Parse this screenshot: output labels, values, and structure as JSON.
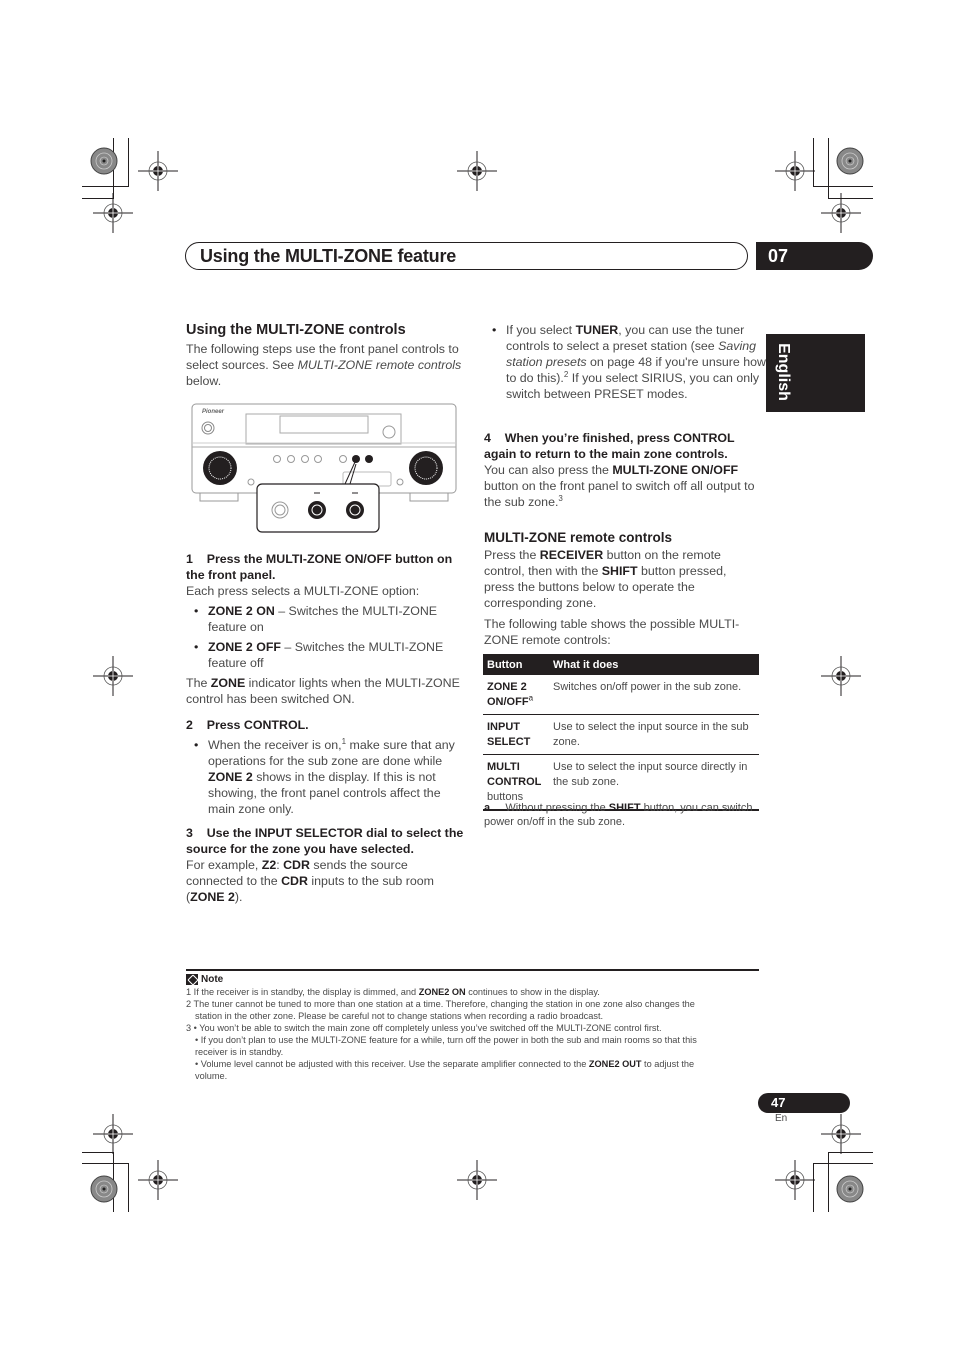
{
  "header": {
    "title": "Using the MULTI-ZONE feature",
    "chapter": "07"
  },
  "side_tab": {
    "language": "English"
  },
  "left_column": {
    "section_title": "Using the MULTI-ZONE controls",
    "intro": {
      "text_1": "The following steps use the front panel controls to select sources. See ",
      "italic": "MULTI-ZONE remote controls",
      "text_2": " below."
    },
    "figure": {
      "brand": "Pioneer",
      "description": "Receiver front panel with MULTI-ZONE ON/OFF and CONTROL buttons highlighted"
    },
    "step1": {
      "num": "1",
      "title": "Press the MULTI-ZONE ON/OFF button on the front panel.",
      "body": "Each press selects a MULTI-ZONE option:",
      "bullets": [
        {
          "bold": "ZONE 2 ON",
          "text": " – Switches the MULTI-ZONE feature on"
        },
        {
          "bold": "ZONE 2 OFF",
          "text": " – Switches the MULTI-ZONE feature off"
        }
      ],
      "after_1": "The ",
      "after_bold": "ZONE",
      "after_2": " indicator lights when the MULTI-ZONE control has been switched ON."
    },
    "step2": {
      "num": "2",
      "title": "Press CONTROL.",
      "bullet_1": "When the receiver is on,",
      "bullet_sup": "1",
      "bullet_2": " make sure that any operations for the sub zone are done while ",
      "bullet_bold": "ZONE 2",
      "bullet_3": " shows in the display. If this is not showing, the front panel controls affect the main zone only."
    },
    "step3": {
      "num": "3",
      "title": "Use the INPUT SELECTOR dial to select the source for the zone you have selected.",
      "t1": "For example, ",
      "b1": "Z2",
      "t2": ": ",
      "b2": "CDR",
      "t3": " sends the source connected to the ",
      "b3": "CDR",
      "t4": " inputs to the sub room (",
      "b4": "ZONE 2",
      "t5": ")."
    }
  },
  "right_column": {
    "tuner_bullet": {
      "t1": "If you select ",
      "b1": "TUNER",
      "t2": ", you can use the tuner controls to select a preset station (see ",
      "i1": "Saving station presets",
      "t3": " on page 48 if you're unsure how to do this).",
      "sup": "2",
      "t4": " If you select SIRIUS, you can only switch between PRESET modes."
    },
    "step4": {
      "num": "4",
      "title": "When you’re finished, press CONTROL again to return to the main zone controls.",
      "t1": "You can also press the ",
      "b1": "MULTI-ZONE ON/OFF",
      "t2": " button on the front panel to switch off all output to the sub zone.",
      "sup": "3"
    },
    "remote_section": {
      "title": "MULTI-ZONE remote controls",
      "t1": "Press the ",
      "b1": "RECEIVER",
      "t2": " button on the remote control, then with the ",
      "b2": "SHIFT",
      "t3": " button pressed, press the buttons below to operate the corresponding zone.",
      "table_intro": "The following table shows the possible MULTI-ZONE remote controls:"
    },
    "table": {
      "headers": [
        "Button",
        "What it does"
      ],
      "rows": [
        {
          "button_1": "ZONE 2",
          "button_2": "ON/OFF",
          "button_sup": "a",
          "button_3": "",
          "description": "Switches on/off power in the sub zone."
        },
        {
          "button_1": "INPUT",
          "button_2": "SELECT",
          "button_sup": "",
          "button_3": "",
          "description": "Use to select the input source in the sub zone."
        },
        {
          "button_1": "MULTI",
          "button_2": "CONTROL",
          "button_sup": "",
          "button_3": "buttons",
          "description": "Use to select the input source directly in the sub zone."
        }
      ],
      "footnote": {
        "label": "a.",
        "t1": "Without pressing the ",
        "b1": "SHIFT",
        "t2": " button, you can switch power on/off in the sub zone."
      }
    }
  },
  "notes": {
    "title": "Note",
    "n1_t1": "1  If the receiver is in standby, the display is dimmed, and ",
    "n1_b": "ZONE2 ON",
    "n1_t2": " continues to show in the display.",
    "n2": "2  The tuner cannot be tuned to more than one station at a time. Therefore, changing the station in one zone also changes the",
    "n2b": "station in the other zone. Please be careful not to change stations when recording a radio broadcast.",
    "n3a": "3  • You won’t be able to switch the main zone off completely unless you’ve switched off the MULTI-ZONE control first.",
    "n3b": "• If you don’t plan to use the MULTI-ZONE feature for a while, turn off the power in both the sub and main rooms so that this",
    "n3b2": "receiver is in standby.",
    "n3c_t1": "• Volume level cannot be adjusted with this receiver. Use the separate amplifier connected to the ",
    "n3c_b": "ZONE2 OUT",
    "n3c_t2": " to adjust the",
    "n3c2": "volume."
  },
  "footer": {
    "page": "47",
    "lang": "En"
  }
}
